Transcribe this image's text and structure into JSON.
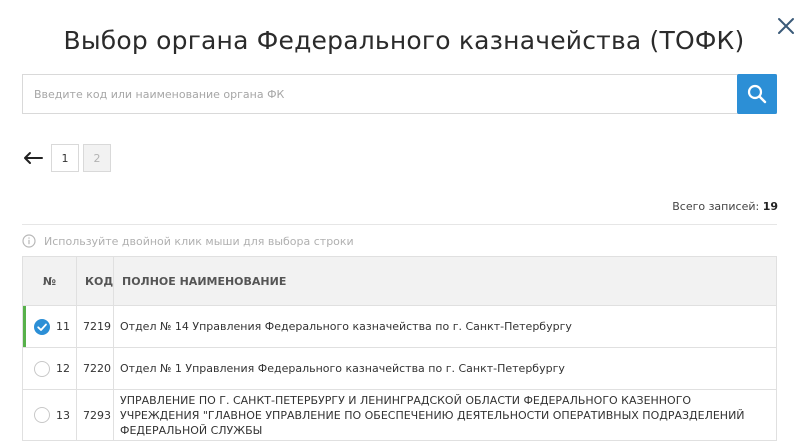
{
  "dialog": {
    "title": "Выбор органа Федерального казначейства (ТОФК)",
    "close_icon": "close-icon"
  },
  "search": {
    "placeholder": "Введите код или наименование органа ФК",
    "value": "",
    "button_icon": "search-icon",
    "accent": "#2c8fd6"
  },
  "pagination": {
    "back_icon": "arrow-left-icon",
    "pages": [
      "1",
      "2"
    ],
    "current_page": "1"
  },
  "summary": {
    "label": "Всего записей:",
    "count": "19"
  },
  "hint": {
    "icon": "info-icon",
    "text": "Используйте двойной клик мыши для выбора строки"
  },
  "table": {
    "headers": {
      "num": "№",
      "code": "КОД",
      "name": "ПОЛНОЕ НАИМЕНОВАНИЕ"
    },
    "rows": [
      {
        "num": "11",
        "code": "7219",
        "name": "Отдел № 14 Управления Федерального казначейства по г. Санкт-Петербургу",
        "selected": true
      },
      {
        "num": "12",
        "code": "7220",
        "name": "Отдел № 1 Управления Федерального казначейства по г. Санкт-Петербургу",
        "selected": false
      },
      {
        "num": "13",
        "code": "7293",
        "name": "УПРАВЛЕНИЕ ПО Г. САНКТ-ПЕТЕРБУРГУ И ЛЕНИНГРАДСКОЙ ОБЛАСТИ ФЕДЕРАЛЬНОГО КАЗЕННОГО УЧРЕЖДЕНИЯ \"ГЛАВНОЕ УПРАВЛЕНИЕ ПО ОБЕСПЕЧЕНИЮ ДЕЯТЕЛЬНОСТИ ОПЕРАТИВНЫХ ПОДРАЗДЕЛЕНИЙ ФЕДЕРАЛЬНОЙ СЛУЖБЫ",
        "selected": false
      }
    ],
    "selected_accent": "#57b14a"
  }
}
